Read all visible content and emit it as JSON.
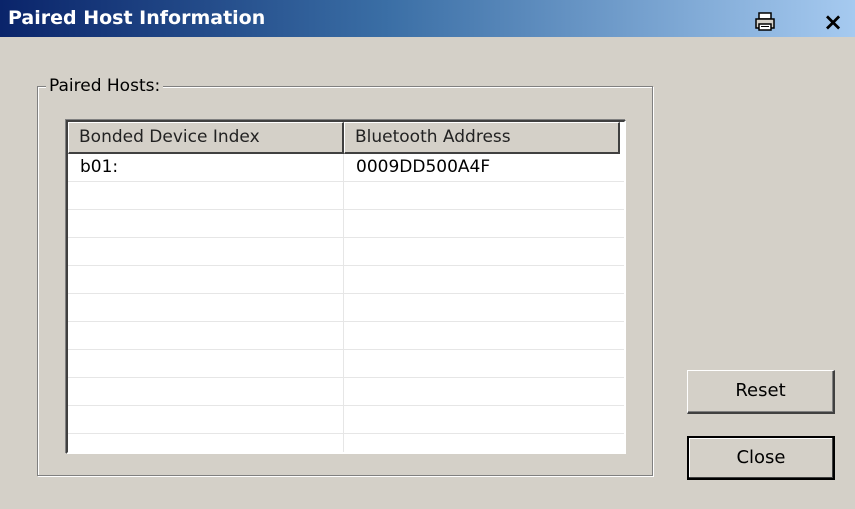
{
  "window": {
    "title": "Paired Host Information",
    "close_glyph": "×",
    "icons": [
      "print-icon",
      "close-icon"
    ]
  },
  "group": {
    "label": "Paired Hosts:"
  },
  "table": {
    "columns": [
      "Bonded Device Index",
      "Bluetooth Address"
    ],
    "rows": [
      [
        "b01:",
        "0009DD500A4F"
      ],
      [
        "",
        ""
      ],
      [
        "",
        ""
      ],
      [
        "",
        ""
      ],
      [
        "",
        ""
      ],
      [
        "",
        ""
      ],
      [
        "",
        ""
      ],
      [
        "",
        ""
      ],
      [
        "",
        ""
      ],
      [
        "",
        ""
      ],
      [
        "",
        ""
      ]
    ]
  },
  "buttons": {
    "reset_label": "Reset",
    "close_label": "Close"
  },
  "colors": {
    "titlebar_start": "#0a246a",
    "titlebar_end": "#a6caf0",
    "face": "#d4d0c8"
  }
}
